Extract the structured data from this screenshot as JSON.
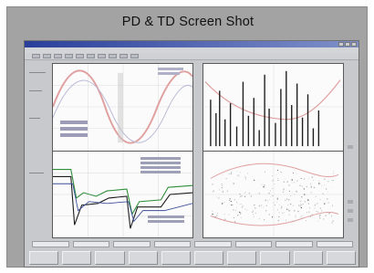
{
  "caption": "PD & TD Screen Shot",
  "window": {
    "title": ""
  },
  "menu": [],
  "toolbar_buttons": 10,
  "fields": [
    "",
    "",
    "",
    "",
    "",
    "",
    "",
    ""
  ],
  "buttons": [
    "",
    "",
    "",
    "",
    "",
    "",
    "",
    "",
    "",
    ""
  ],
  "panels": {
    "top_left": {
      "kind": "sine waveform",
      "title": ""
    },
    "top_right": {
      "kind": "pulse spikes",
      "title": ""
    },
    "bottom_left": {
      "kind": "transient traces",
      "title": ""
    },
    "bottom_right": {
      "kind": "scatter pattern",
      "title": ""
    }
  },
  "colors": {
    "frame": "#a3a3a3",
    "app_bg": "#c7c9cd",
    "sine_primary": "#e0a0a0",
    "trace_green": "#2f8f3a"
  }
}
